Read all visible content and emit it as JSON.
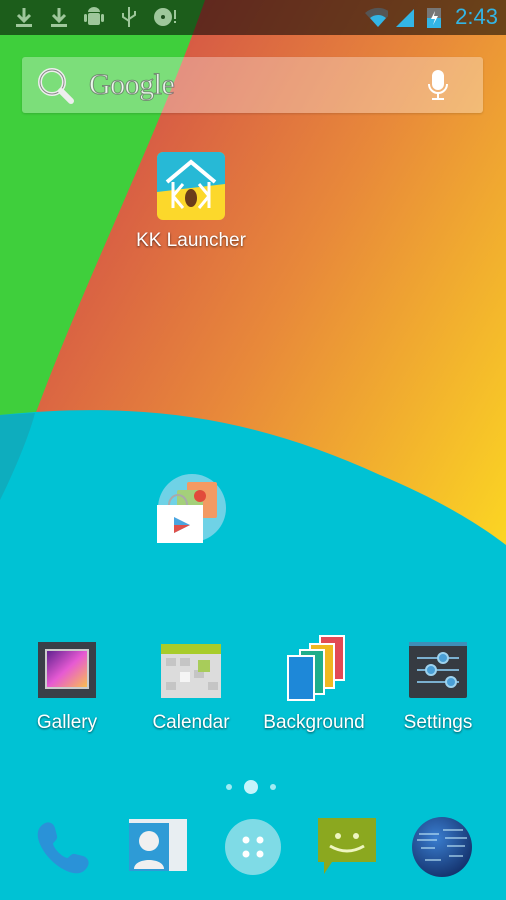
{
  "status_bar": {
    "notification_icons": [
      "download-icon",
      "download-icon",
      "android-debug-icon",
      "usb-icon",
      "sd-card-icon"
    ],
    "system_icons": [
      "wifi-icon",
      "signal-icon",
      "battery-charging-icon"
    ],
    "time": "2:43",
    "accent": "#33b5e5"
  },
  "search": {
    "label": "Google",
    "search_icon": "search-icon",
    "voice_icon": "mic-icon"
  },
  "desktop": {
    "apps": [
      {
        "label": "KK Launcher",
        "icon": "kk-launcher-icon"
      },
      {
        "label": "",
        "icon": "play-store-folder-icon"
      }
    ]
  },
  "hotseat_row": [
    {
      "label": "Gallery",
      "icon": "gallery-icon"
    },
    {
      "label": "Calendar",
      "icon": "calendar-icon"
    },
    {
      "label": "Background",
      "icon": "wallpaper-icon"
    },
    {
      "label": "Settings",
      "icon": "settings-icon"
    }
  ],
  "page_indicator": {
    "pages": 3,
    "current": 2
  },
  "dock": [
    {
      "name": "Phone",
      "icon": "phone-icon"
    },
    {
      "name": "People",
      "icon": "contacts-icon"
    },
    {
      "name": "Apps",
      "icon": "app-drawer-icon"
    },
    {
      "name": "Messaging",
      "icon": "messaging-icon"
    },
    {
      "name": "Browser",
      "icon": "globe-icon"
    }
  ],
  "colors": {
    "green": "#3fcf3c",
    "red": "#c8344e",
    "orange": "#ec9a3a",
    "yellow": "#fbd91e",
    "teal": "#00c2d4"
  }
}
